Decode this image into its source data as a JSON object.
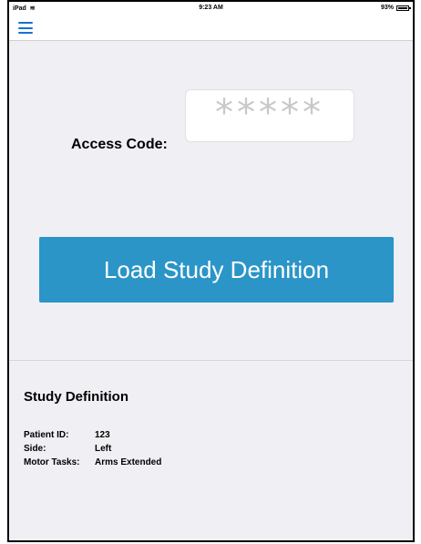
{
  "status_bar": {
    "carrier": "iPad",
    "time": "9:23 AM",
    "battery": "93%"
  },
  "access": {
    "label": "Access Code:",
    "placeholder": "*****"
  },
  "load_button": {
    "label": "Load Study Definition",
    "color": "#2b95c8"
  },
  "study": {
    "title": "Study Definition",
    "rows": [
      {
        "key": "Patient ID:",
        "value": "123"
      },
      {
        "key": "Side:",
        "value": "Left"
      },
      {
        "key": "Motor Tasks:",
        "value": "Arms Extended"
      }
    ]
  },
  "colors": {
    "background": "#efeff4",
    "accent": "#1a6fd6"
  },
  "icons": [
    "menu-icon",
    "wifi-icon",
    "battery-icon"
  ]
}
